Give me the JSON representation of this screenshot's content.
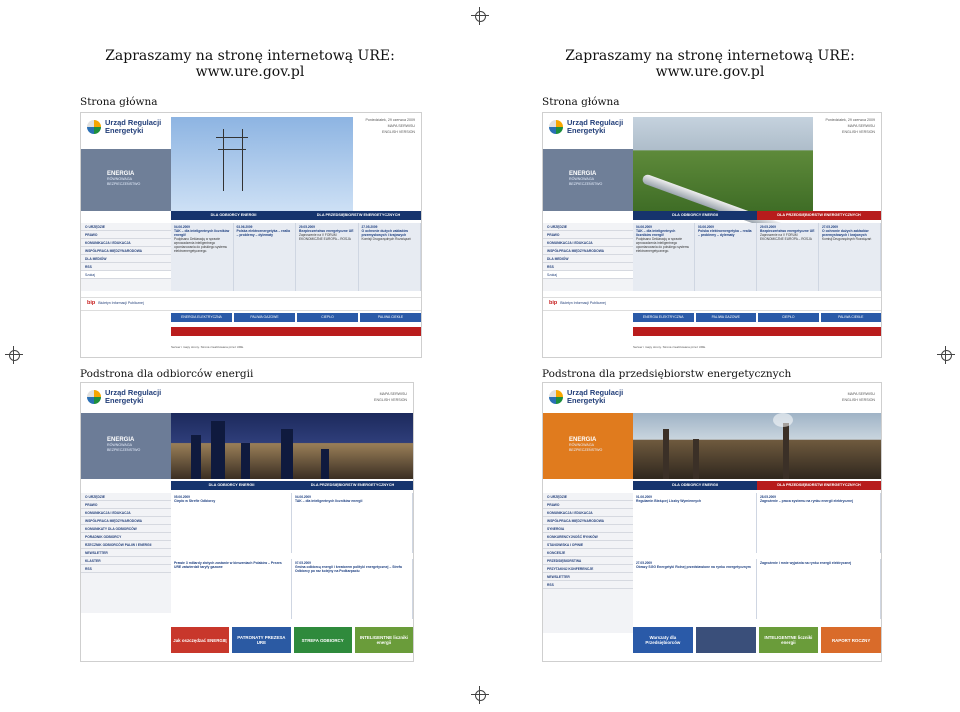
{
  "top_left": {
    "line1": "Zapraszamy na stronę internetową URE:",
    "line2": "www.ure.gov.pl"
  },
  "top_right": {
    "line1": "Zapraszamy na stronę internetową URE:",
    "line2": "www.ure.gov.pl"
  },
  "captions": {
    "home1": "Strona główna",
    "home2": "Strona główna",
    "consumers": "Podstrona dla odbiorców energii",
    "companies": "Podstrona dla przedsiębiorstw energetycznych"
  },
  "site": {
    "logo_line1": "Urząd Regulacji",
    "logo_line2": "Energetyki",
    "topinfo_date": "Poniedziałek, 29 czerwca 2009",
    "topinfo_map": "MAPA SERWISU",
    "topinfo_en": "ENGLISH VERSION",
    "energia": "ENERGIA",
    "energia_sub1": "RÓWNOWAGA",
    "energia_sub2": "BEZPIECZEŃSTWO",
    "tab1": "DLA ODBIORCY ENERGII",
    "tab2": "DLA PRZEDSIĘBIORSTW ENERGETYCZNYCH",
    "side": [
      "O URZĘDZIE",
      "PRAWO",
      "KOMUNIKACJA I EDUKACJA",
      "WSPÓŁPRACA MIĘDZYNARODOWA",
      "DLA MEDIÓW",
      "RSS"
    ],
    "news": [
      {
        "date": "04.06.2009",
        "title": "TAK – dla inteligentnych liczników energii!",
        "body": "Podpisano Deklarację w sprawie wprowadzenia inteligentnego opomiarowania do polskiego systemu elektroenergetycznego."
      },
      {
        "date": "03.06.2009",
        "title": "Polska elektroenergetyka – realia – problemy – dylematy",
        "body": ""
      },
      {
        "date": "29.05.2009",
        "title": "Bezpieczeństwo energetyczne UE",
        "body": "Zaproszenie na V FORUM EKONOMICZNE EUROPA – ROSJA"
      },
      {
        "date": "27.05.2009",
        "title": "O ochronie dużych zakładów przemysłowych i krajowych",
        "body": "Komisji Drugorzędnych Rozwiązań"
      }
    ],
    "search": "Szukaj",
    "bip": "bip",
    "bip_text": "Biuletyn Informacji Publicznej",
    "more": "więcej »",
    "bottom_tabs": [
      "ENERGIA ELEKTRYCZNA",
      "PALIWA GAZOWE",
      "CIEPŁO",
      "PALIWA CIEKŁE"
    ],
    "footer": "Serwer i mapy strony. Strona zrealizowana przez URE."
  },
  "consumer_page": {
    "side": [
      "O URZĘDZIE",
      "PRAWO",
      "KOMUNIKACJA I EDUKACJA",
      "WSPÓŁPRACA MIĘDZYNARODOWA",
      "KOMUNIKATY DLA ODBIORCÓW",
      "PORADNIK ODBIORCY",
      "RZECZNIK ODBIORCÓW PALIW I ENERGII",
      "NEWSLETTER",
      "KLASTER",
      "RSS"
    ],
    "news": [
      {
        "date": "05.06.2009",
        "title": "Ciepło w Strefie Odbiorcy"
      },
      {
        "date": "04.06.2009",
        "title": "TAK – dla inteligentnych liczników energii"
      },
      {
        "date": "",
        "title": "Prawie 3 miliardy złotych zostanie w kieszeniach Polaków – Prezes URE zatwierdził taryfy gazowe"
      },
      {
        "date": "07.05.2009",
        "title": "Gmina odbiorcą energii i kreatorem polityki energetycznej – Strefa Odbiorcy po raz kolejny na Podkarpaciu"
      }
    ],
    "tiles": [
      "Jak oszczędzać ENERGIĘ",
      "PATRONATY PREZESA URE",
      "STREFA ODBIORCY",
      "INTELIGENTNE liczniki energii"
    ]
  },
  "company_page": {
    "side": [
      "O URZĘDZIE",
      "PRAWO",
      "KOMUNIKACJA I EDUKACJA",
      "WSPÓŁPRACA MIĘDZYNARODOWA",
      "SYNERGIA",
      "KONKURENCYJNOŚĆ RYNKÓW",
      "STANOWISKA I OPINIE",
      "KONCESJE",
      "PRZEDSIĘBIORSTWA",
      "PRZYTAKNIJ KONFERENCJE",
      "NEWSLETTER",
      "RSS"
    ],
    "news": [
      {
        "date": "01.06.2009",
        "title": "Regulamin Bieżącej Liczby Wymiennych"
      },
      {
        "date": "28.05.2009",
        "title": "Zagrożenie – praca systemu na rynku energii elektrycznej"
      },
      {
        "date": "27.05.2009",
        "title": "Obrazy SGG Energetyki Rolnej przedstawione na rynku energetycznym"
      },
      {
        "date": "",
        "title": "Zagrożenie i mnie wyjaśnia na rynku energii elektrycznej"
      }
    ],
    "tiles": [
      "Warszaty dla Przedsiębiorców",
      "",
      "INTELIGENTNE liczniki energii",
      "RAPORT ROCZNY"
    ]
  }
}
